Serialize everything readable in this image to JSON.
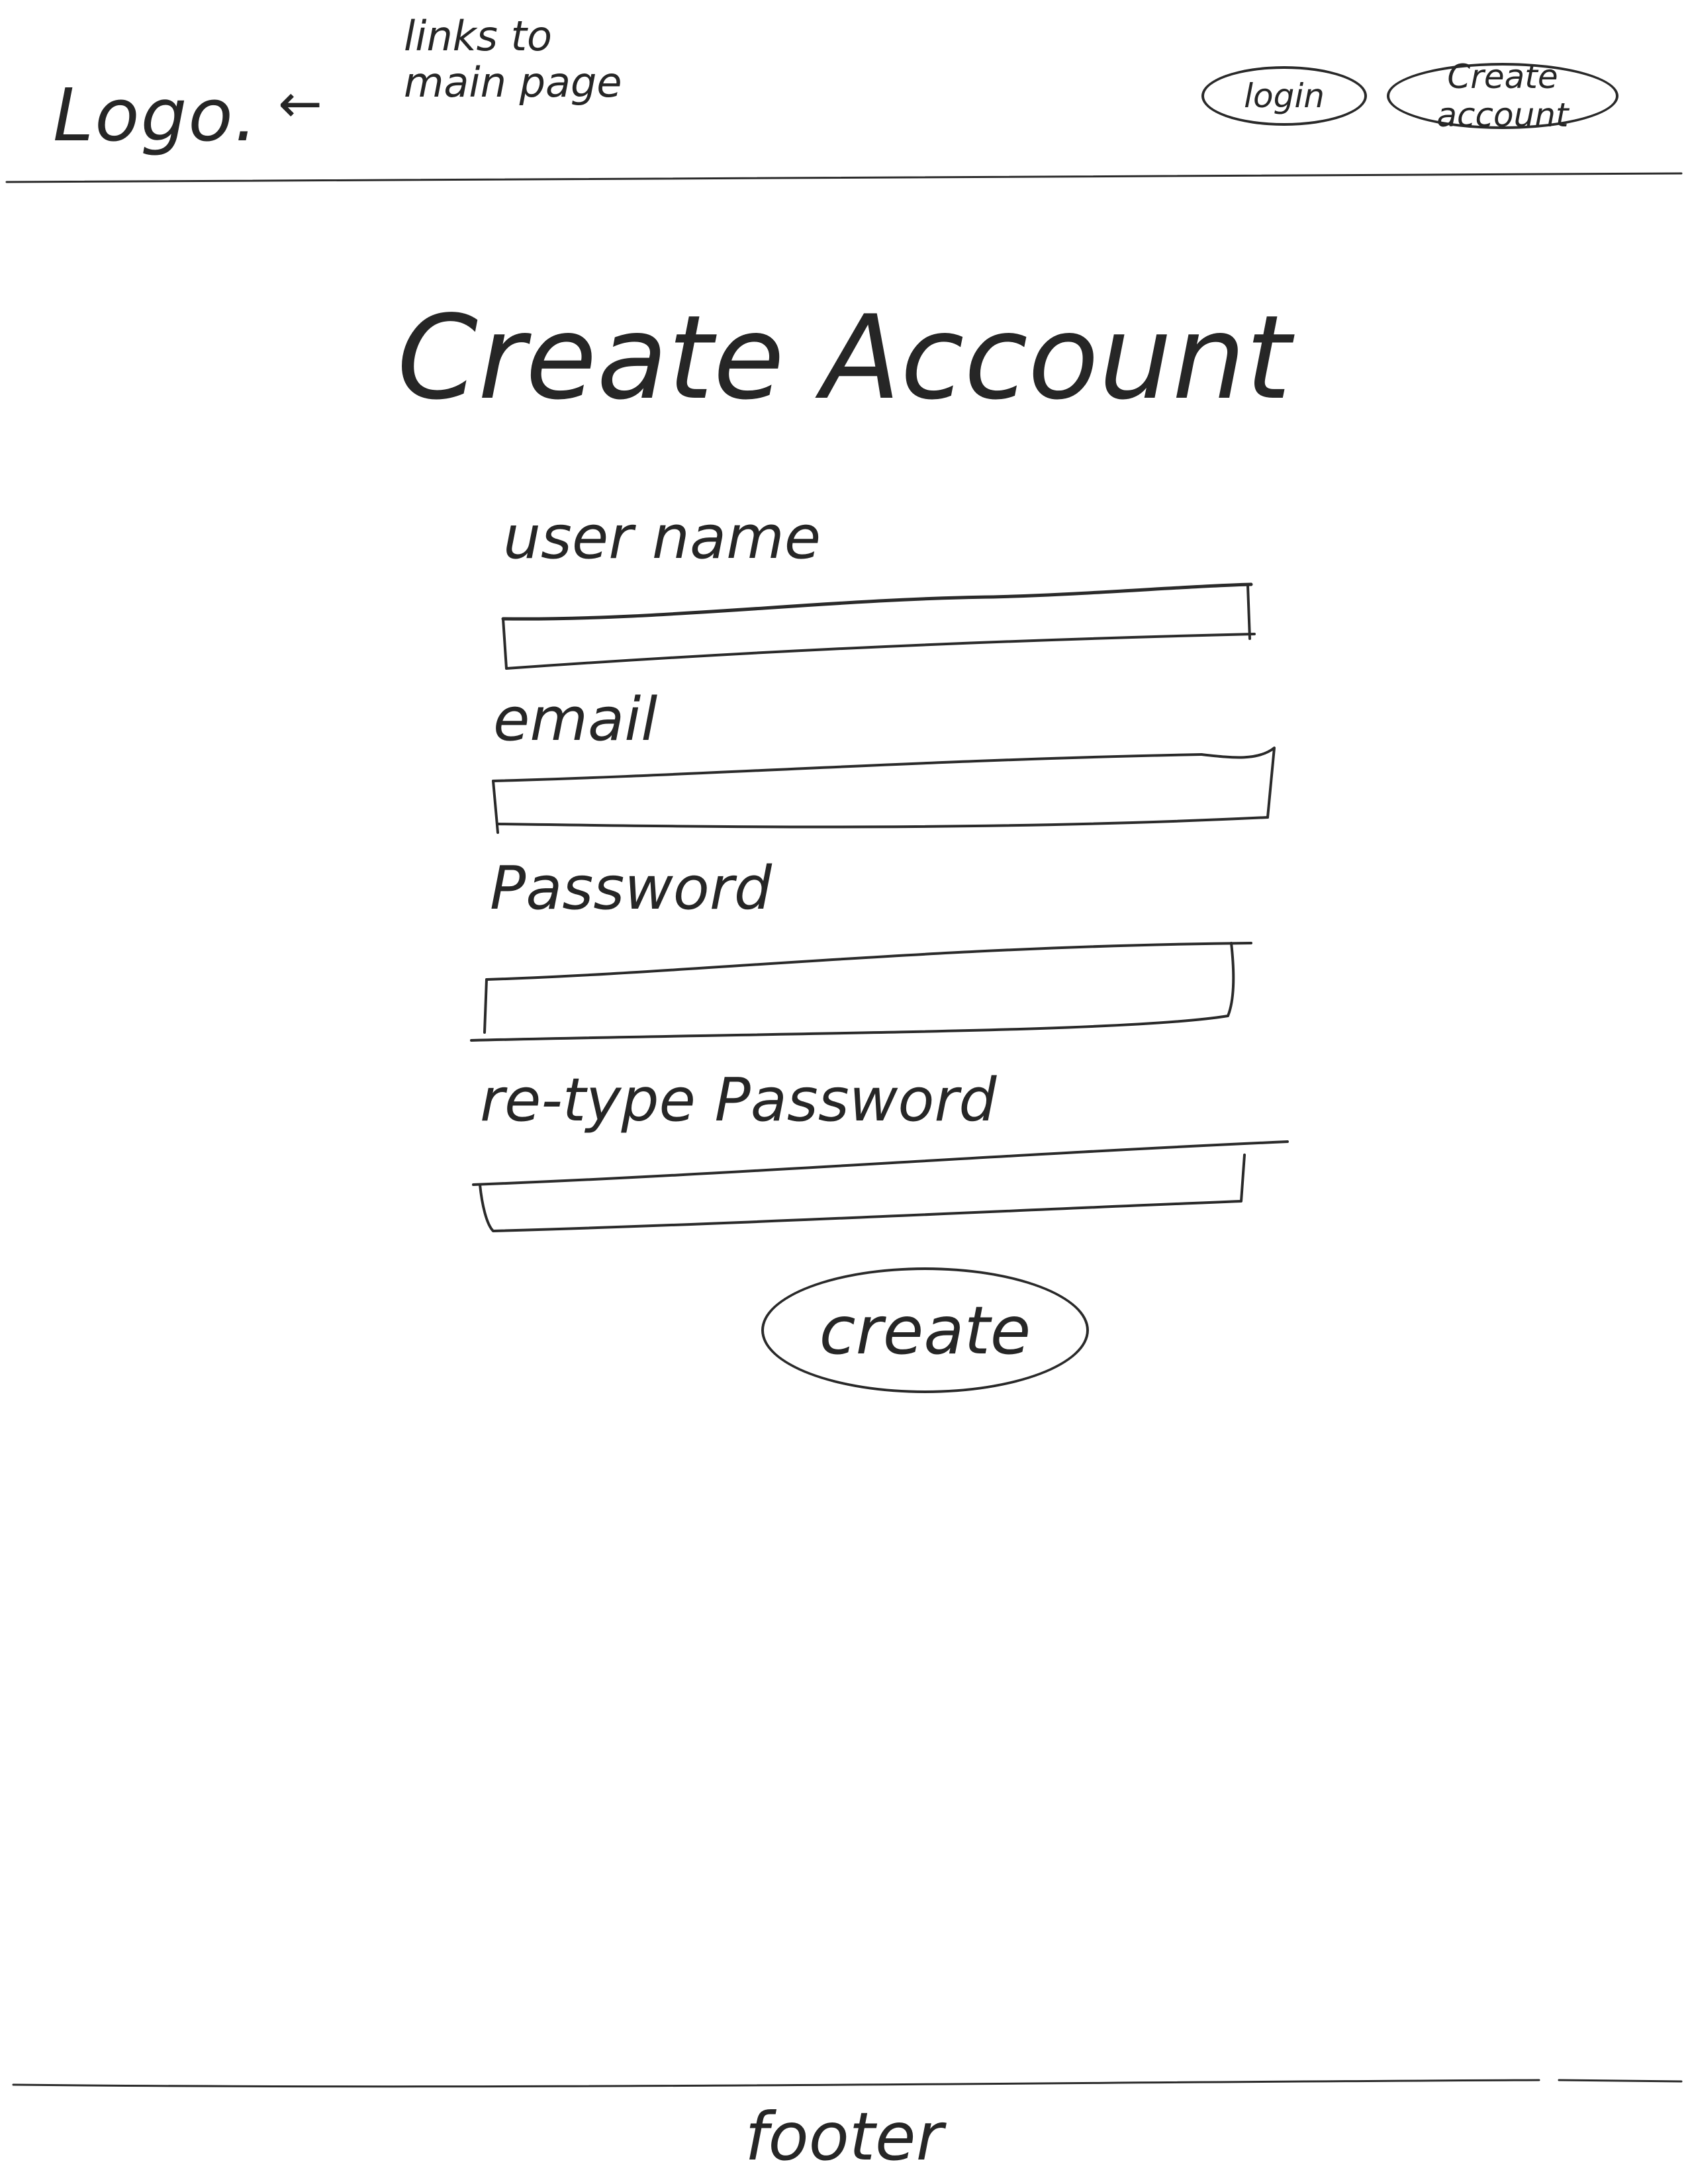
{
  "header": {
    "logo": "Logo.",
    "arrow": "←",
    "logo_annotation": "links to main page",
    "login_label": "login",
    "create_account_label": "Create account"
  },
  "main": {
    "title": "Create Account",
    "fields": [
      {
        "label": "user name",
        "value": "",
        "placeholder": ""
      },
      {
        "label": "email",
        "value": "",
        "placeholder": ""
      },
      {
        "label": "Password",
        "value": "",
        "placeholder": ""
      },
      {
        "label": "re-type Password",
        "value": "",
        "placeholder": ""
      }
    ],
    "submit_label": "create"
  },
  "footer": {
    "text": "footer"
  }
}
